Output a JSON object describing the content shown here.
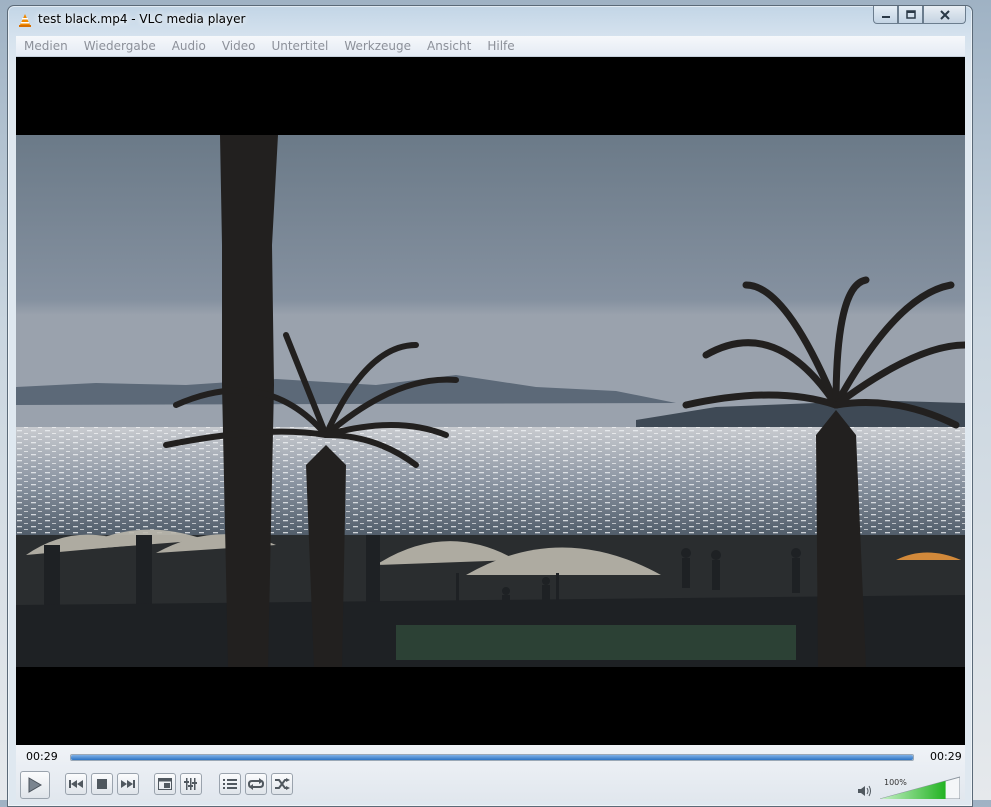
{
  "window": {
    "title": "test black.mp4 - VLC media player"
  },
  "menu": {
    "items": [
      "Medien",
      "Wiedergabe",
      "Audio",
      "Video",
      "Untertitel",
      "Werkzeuge",
      "Ansicht",
      "Hilfe"
    ]
  },
  "playback": {
    "elapsed": "00:29",
    "duration": "00:29",
    "progress": 1.0,
    "volume_label": "100%",
    "volume": 1.0
  },
  "colors": {
    "seek_fill": "#2d74c4",
    "volume_fill": "#3cc43c"
  },
  "icons": {
    "play": "play-icon",
    "prev": "previous-icon",
    "stop": "stop-icon",
    "next": "next-icon",
    "fullscreen": "fullscreen-icon",
    "extended": "extended-settings-icon",
    "playlist": "playlist-icon",
    "loop": "loop-icon",
    "shuffle": "shuffle-icon",
    "speaker": "speaker-icon"
  }
}
